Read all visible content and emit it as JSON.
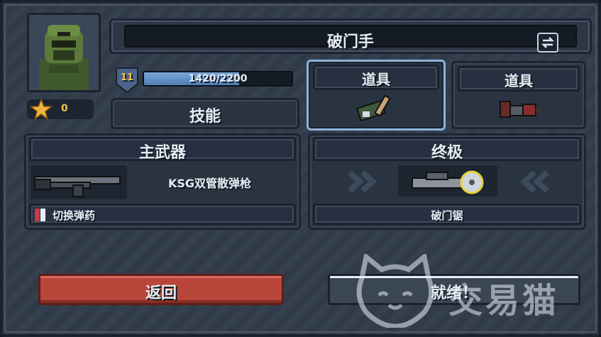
{
  "character": {
    "name": "破门手",
    "stars": "0"
  },
  "level": {
    "value": "11",
    "xp_text": "1420/2200",
    "xp_fraction": 0.645
  },
  "skill_label": "技能",
  "items": [
    {
      "label": "道具",
      "icon": "hammer-icon"
    },
    {
      "label": "道具",
      "icon": "grenade-icon"
    }
  ],
  "primary_weapon": {
    "header": "主武器",
    "name": "KSG双管散弹枪",
    "ammo_switch": "切换弹药"
  },
  "ultimate": {
    "header": "终极",
    "name": "破门锯"
  },
  "buttons": {
    "back": "返回",
    "ready": "就绪！"
  },
  "watermark": "交易猫",
  "colors": {
    "back_button": "#b8463a",
    "xp_fill": "#5b8cc4",
    "star": "#f2b43a",
    "selected_border": "#8fb3d8"
  }
}
